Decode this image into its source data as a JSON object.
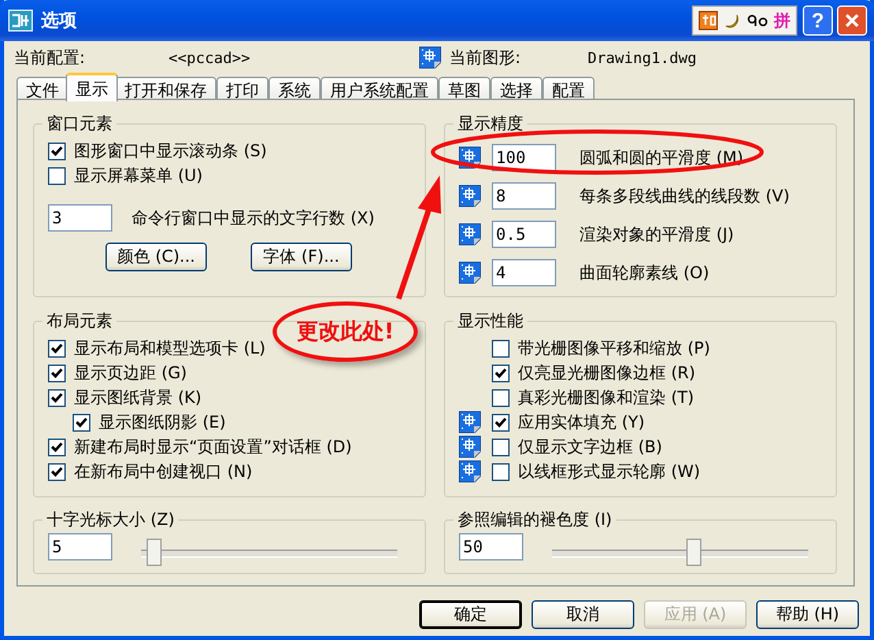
{
  "window": {
    "title": "选项",
    "help": "?"
  },
  "ime": {
    "mode": "拼"
  },
  "header": {
    "profile_label": "当前配置:",
    "profile": "<<pccad>>",
    "drawing_label": "当前图形:",
    "drawing": "Drawing1.dwg"
  },
  "tabs": [
    {
      "label": "文件",
      "selected": false
    },
    {
      "label": "显示",
      "selected": true
    },
    {
      "label": "打开和保存",
      "selected": false
    },
    {
      "label": "打印",
      "selected": false
    },
    {
      "label": "系统",
      "selected": false
    },
    {
      "label": "用户系统配置",
      "selected": false
    },
    {
      "label": "草图",
      "selected": false
    },
    {
      "label": "选择",
      "selected": false
    },
    {
      "label": "配置",
      "selected": false
    }
  ],
  "window_elements": {
    "title": "窗口元素",
    "checkboxes": [
      {
        "label": "图形窗口中显示滚动条 (S)",
        "checked": true
      },
      {
        "label": "显示屏幕菜单 (U)",
        "checked": false
      }
    ],
    "field": {
      "value": "3",
      "label": "命令行窗口中显示的文字行数 (X)"
    },
    "buttons": [
      "颜色 (C)...",
      "字体 (F)..."
    ]
  },
  "layout_elements": {
    "title": "布局元素",
    "checkboxes": [
      {
        "label": "显示布局和模型选项卡 (L)",
        "checked": true
      },
      {
        "label": "显示页边距 (G)",
        "checked": true
      },
      {
        "label": "显示图纸背景 (K)",
        "checked": true,
        "children": [
          {
            "label": "显示图纸阴影 (E)",
            "checked": true
          }
        ]
      },
      {
        "label": "新建布局时显示“页面设置”对话框 (D)",
        "checked": true
      },
      {
        "label": "在新布局中创建视口 (N)",
        "checked": true
      }
    ]
  },
  "crosshair": {
    "title": "十字光标大小 (Z)",
    "value": "5",
    "level": 0.05
  },
  "precision": {
    "title": "显示精度",
    "rows": [
      {
        "value": "100",
        "label": "圆弧和圆的平滑度 (M)"
      },
      {
        "value": "8",
        "label": "每条多段线曲线的线段数 (V)"
      },
      {
        "value": "0.5",
        "label": "渲染对象的平滑度 (J)"
      },
      {
        "value": "4",
        "label": "曲面轮廓素线 (O)"
      }
    ]
  },
  "performance": {
    "title": "显示性能",
    "checkboxes": [
      {
        "label": "带光栅图像平移和缩放 (P)",
        "checked": false,
        "drawing_icon": false
      },
      {
        "label": "仅亮显光栅图像边框 (R)",
        "checked": true,
        "drawing_icon": false
      },
      {
        "label": "真彩光栅图像和渲染 (T)",
        "checked": false,
        "drawing_icon": false
      },
      {
        "label": "应用实体填充 (Y)",
        "checked": true,
        "drawing_icon": true
      },
      {
        "label": "仅显示文字边框 (B)",
        "checked": false,
        "drawing_icon": true
      },
      {
        "label": "以线框形式显示轮廓 (W)",
        "checked": false,
        "drawing_icon": true
      }
    ]
  },
  "fade": {
    "title": "参照编辑的褪色度 (I)",
    "value": "50",
    "level": 0.55
  },
  "buttons": [
    {
      "label": "确定",
      "default": true,
      "disabled": false
    },
    {
      "label": "取消",
      "default": false,
      "disabled": false
    },
    {
      "label": "应用 (A)",
      "default": false,
      "disabled": true
    },
    {
      "label": "帮助 (H)",
      "default": false,
      "disabled": false
    }
  ],
  "annotation": {
    "callout": "更改此处!"
  }
}
